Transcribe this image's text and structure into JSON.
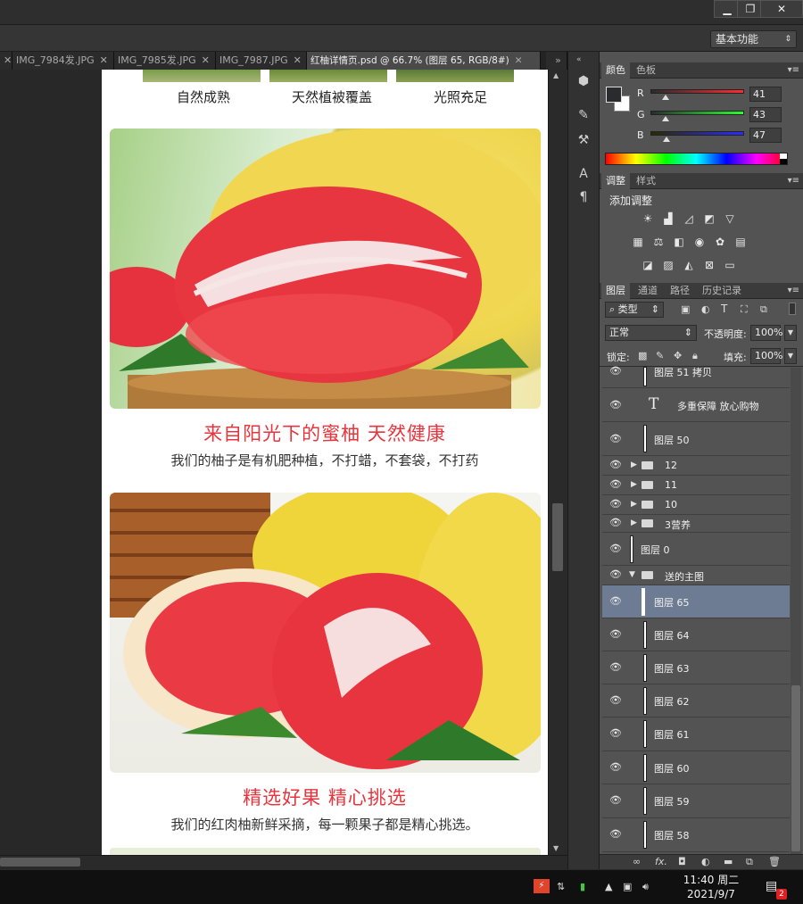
{
  "tabs": [
    {
      "label": "IMG_7984发.JPG",
      "active": false
    },
    {
      "label": "IMG_7985发.JPG",
      "active": false
    },
    {
      "label": "IMG_7987.JPG",
      "active": false
    },
    {
      "label": "红柚详情页.psd @ 66.7% (图层 65, RGB/8#)",
      "active": true
    }
  ],
  "tab_overflow_icon": "double-chevron-right-icon",
  "workspace": {
    "label": "基本功能"
  },
  "window_controls": [
    "minimize-icon",
    "restore-icon",
    "close-icon"
  ],
  "document": {
    "features": [
      "自然成熟",
      "天然植被覆盖",
      "光照充足"
    ],
    "sections": [
      {
        "headline": "来自阳光下的蜜柚 天然健康",
        "subline": "我们的柚子是有机肥种植，不打蜡，不套袋，不打药"
      },
      {
        "headline": "精选好果 精心挑选",
        "subline": "我们的红肉柚新鲜采摘，每一颗果子都是精心挑选。"
      }
    ]
  },
  "color_panel": {
    "tabs": [
      "颜色",
      "色板"
    ],
    "channels": [
      {
        "label": "R",
        "value": "41"
      },
      {
        "label": "G",
        "value": "43"
      },
      {
        "label": "B",
        "value": "47"
      }
    ],
    "foreground": "#292b2f"
  },
  "adjustments_panel": {
    "tabs": [
      "调整",
      "样式"
    ],
    "title": "添加调整"
  },
  "layers_panel": {
    "tabs": [
      "图层",
      "通道",
      "路径",
      "历史记录"
    ],
    "filter_kind": "类型",
    "blend_mode": "正常",
    "opacity_label": "不透明度:",
    "opacity_value": "100%",
    "lock_label": "锁定:",
    "fill_label": "填充:",
    "fill_value": "100%",
    "layers": [
      {
        "name": "图层 51 拷贝",
        "kind": "layer",
        "selected": false
      },
      {
        "name": "多重保障 放心购物",
        "kind": "text",
        "selected": false
      },
      {
        "name": "图层 50",
        "kind": "layer",
        "selected": false
      },
      {
        "name": "12",
        "kind": "group",
        "selected": false
      },
      {
        "name": "11",
        "kind": "group",
        "selected": false
      },
      {
        "name": "10",
        "kind": "group",
        "selected": false
      },
      {
        "name": "3营养",
        "kind": "group",
        "selected": false
      },
      {
        "name": "图层 0",
        "kind": "layer",
        "selected": false
      },
      {
        "name": "送的主图",
        "kind": "group-open",
        "selected": false
      },
      {
        "name": "图层 65",
        "kind": "layer",
        "selected": true
      },
      {
        "name": "图层 64",
        "kind": "layer",
        "selected": false
      },
      {
        "name": "图层 63",
        "kind": "layer",
        "selected": false
      },
      {
        "name": "图层 62",
        "kind": "layer",
        "selected": false
      },
      {
        "name": "图层 61",
        "kind": "layer",
        "selected": false
      },
      {
        "name": "图层 60",
        "kind": "layer",
        "selected": false
      },
      {
        "name": "图层 59",
        "kind": "layer",
        "selected": false
      },
      {
        "name": "图层 58",
        "kind": "layer",
        "selected": false
      }
    ],
    "bottom_icons": [
      "link-icon",
      "fx-icon",
      "mask-icon",
      "adjustment-icon",
      "folder-icon",
      "new-layer-icon",
      "trash-icon"
    ]
  },
  "taskbar": {
    "time": "11:40 周二",
    "date": "2021/9/7",
    "notification_count": "2"
  }
}
